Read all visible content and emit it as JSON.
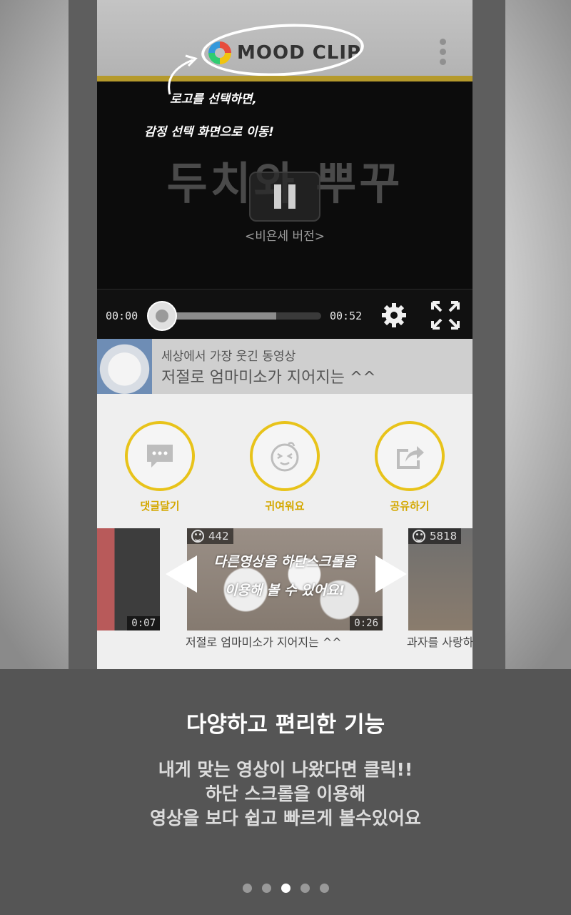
{
  "header": {
    "logo_text": "MOOD CLIP",
    "hint_line1": "로고를 선택하면,",
    "hint_line2": "감정 선택 화면으로 이동!"
  },
  "video": {
    "title": "두치와 뿌꾸",
    "subtitle": "<비욘세 버전>",
    "current_time": "00:00",
    "duration": "00:52",
    "buffered_fraction": 0.72,
    "state": "playing"
  },
  "info": {
    "line1": "세상에서 가장 웃긴 동영상",
    "line2": "저절로 엄마미소가 지어지는 ^^"
  },
  "actions": [
    {
      "label": "댓글달기",
      "icon": "comment-icon"
    },
    {
      "label": "귀여워요",
      "icon": "cute-face-icon"
    },
    {
      "label": "공유하기",
      "icon": "share-icon"
    }
  ],
  "related": {
    "hint_line1": "다른영상을 하단스크롤을",
    "hint_line2": "이용해 볼 수 있어요!",
    "cards": [
      {
        "duration": "0:07",
        "views": "",
        "caption": ""
      },
      {
        "duration": "0:26",
        "views": "442",
        "caption": "저절로 엄마미소가 지어지는 ^^"
      },
      {
        "duration": "",
        "views": "5818",
        "caption": "과자를 사랑하"
      }
    ]
  },
  "bottom": {
    "title": "다양하고 편리한 기능",
    "desc_line1": "내게 맞는 영상이 나왔다면 클릭!!",
    "desc_line2": "하단 스크롤을 이용해",
    "desc_line3": "영상을 보다 쉽고 빠르게 볼수있어요"
  },
  "pager": {
    "total": 5,
    "current": 3
  },
  "colors": {
    "accent": "#e8c31a",
    "bottom_bg": "#555555",
    "header_rule": "#b59a2c"
  }
}
